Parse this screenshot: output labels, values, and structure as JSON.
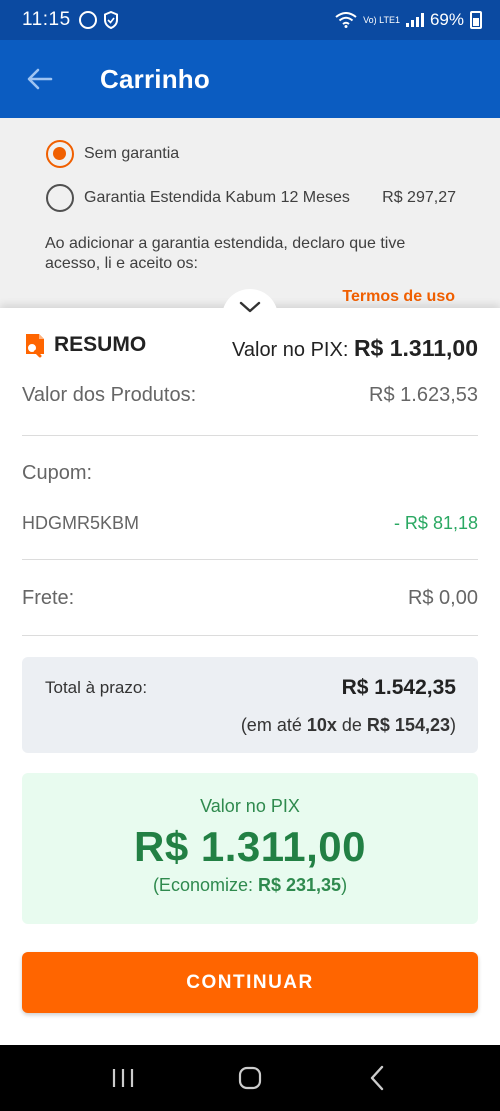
{
  "status_bar": {
    "time": "11:15",
    "network": "Vo) LTE1",
    "battery": "69%"
  },
  "app_bar": {
    "title": "Carrinho",
    "back_icon": "arrow-left-icon"
  },
  "warranty": {
    "options": [
      {
        "label": "Sem garantia",
        "selected": true,
        "price": ""
      },
      {
        "label": "Garantia Estendida Kabum 12 Meses",
        "selected": false,
        "price": "R$ 297,27"
      }
    ],
    "terms_text": "Ao adicionar a garantia estendida, declaro que tive acesso, li e aceito os:",
    "terms_link": "Termos de uso"
  },
  "summary": {
    "title": "RESUMO",
    "pix_header_label": "Valor no PIX:",
    "pix_header_value": "R$ 1.311,00",
    "products_label": "Valor dos Produtos:",
    "products_value": "R$ 1.623,53",
    "coupon_label": "Cupom:",
    "coupon_code": "HDGMR5KBM",
    "coupon_discount": "- R$ 81,18",
    "shipping_label": "Frete:",
    "shipping_value": "R$ 0,00",
    "total_label": "Total à prazo:",
    "total_value": "R$ 1.542,35",
    "installment_prefix": "(em até ",
    "installment_count": "10x",
    "installment_mid": " de ",
    "installment_value": "R$ 154,23",
    "installment_suffix": ")",
    "pix_caption": "Valor no PIX",
    "pix_big_value": "R$ 1.311,00",
    "economy_prefix": "(Economize: ",
    "economy_value": "R$ 231,35",
    "economy_suffix": ")"
  },
  "cta": {
    "label": "CONTINUAR"
  },
  "colors": {
    "status_bar": "#0b4aa1",
    "app_bar": "#0b5cc1",
    "accent_orange": "#ff6500",
    "pix_green": "#228044",
    "discount_green": "#2aa862"
  }
}
